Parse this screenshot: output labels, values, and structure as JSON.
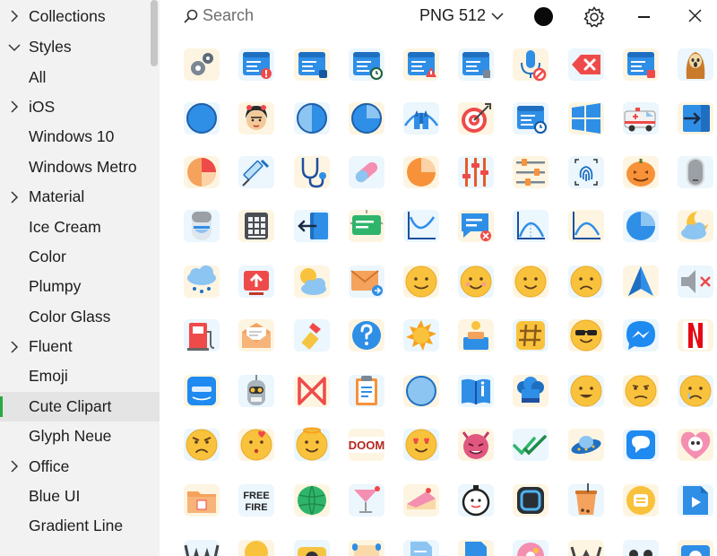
{
  "sidebar": {
    "items": [
      {
        "label": "Collections",
        "expandable": true,
        "expanded": false
      },
      {
        "label": "Styles",
        "expandable": true,
        "expanded": true
      },
      {
        "label": "All"
      },
      {
        "label": "iOS",
        "expandable": true,
        "expanded": false
      },
      {
        "label": "Windows 10"
      },
      {
        "label": "Windows Metro"
      },
      {
        "label": "Material",
        "expandable": true,
        "expanded": false
      },
      {
        "label": "Ice Cream"
      },
      {
        "label": "Color"
      },
      {
        "label": "Plumpy"
      },
      {
        "label": "Color Glass"
      },
      {
        "label": "Fluent",
        "expandable": true,
        "expanded": false
      },
      {
        "label": "Emoji"
      },
      {
        "label": "Cute Clipart",
        "selected": true
      },
      {
        "label": "Glyph Neue"
      },
      {
        "label": "Office",
        "expandable": true,
        "expanded": false
      },
      {
        "label": "Blue UI"
      },
      {
        "label": "Gradient Line"
      }
    ]
  },
  "toolbar": {
    "search_placeholder": "Search",
    "format_label": "PNG 512",
    "color_swatch": "#0a0a0a"
  },
  "colors": {
    "selected_accent": "#27a844",
    "sidebar_bg": "#f2f2f2",
    "blue": "#2f8ee6",
    "yellow": "#f9c23c",
    "red": "#ef4a4a"
  },
  "icons": [
    [
      "gears-icon",
      "website-error-icon",
      "website-user-icon",
      "website-clock-icon",
      "website-warning-icon",
      "website-delete-icon",
      "microphone-off-icon",
      "backspace-icon",
      "website-stop-icon",
      "scream-icon"
    ],
    [
      "blue-circle-icon",
      "frida-kahlo-icon",
      "half-circle-icon",
      "pie-circle-icon",
      "disney-castle-icon",
      "target-icon",
      "calendar-clock-icon",
      "windows-logo-icon",
      "ambulance-icon",
      "import-icon"
    ],
    [
      "pie-chart-icon",
      "syringe-icon",
      "stethoscope-icon",
      "pill-icon",
      "pie-chart-orange-icon",
      "equalizer-icon",
      "sliders-icon",
      "fingerprint-icon",
      "pumpkin-icon",
      "capsule-icon"
    ],
    [
      "humidifier-icon",
      "calculator-icon",
      "logout-icon",
      "announcement-icon",
      "bell-curve-icon",
      "chat-error-icon",
      "arch-chart-icon",
      "parabola-chart-icon",
      "pie-quarter-icon",
      "moon-cloud-icon"
    ],
    [
      "snow-cloud-icon",
      "cloud-upload-icon",
      "partly-cloudy-icon",
      "forward-mail-icon",
      "smile-emoji-icon",
      "blush-emoji-icon",
      "happy-emoji-icon",
      "worried-emoji-icon",
      "location-arrow-icon",
      "mute-icon"
    ],
    [
      "gas-station-icon",
      "open-envelope-icon",
      "lipstick-icon",
      "help-icon",
      "sun-icon",
      "podium-icon",
      "hashtag-icon",
      "cool-emoji-icon",
      "messenger-icon",
      "netflix-icon"
    ],
    [
      "amazon-music-icon",
      "bender-icon",
      "makerbot-icon",
      "clipboard-icon",
      "circle-icon",
      "book-info-icon",
      "chef-hat-icon",
      "grin-emoji-icon",
      "sad-emoji-icon",
      "crying-emoji-icon"
    ],
    [
      "angry-emoji-icon",
      "kiss-emoji-icon",
      "angel-emoji-icon",
      "doom-icon",
      "heart-eyes-emoji-icon",
      "devil-emoji-icon",
      "double-check-icon",
      "ufo-icon",
      "chat-bubble-icon",
      "heart-skull-icon"
    ],
    [
      "folder-icon",
      "free-fire-icon",
      "watermelon-icon",
      "cocktail-icon",
      "cake-icon",
      "smiley-stopwatch-icon",
      "rounded-square-icon",
      "bubble-tea-icon",
      "letter-bubble-icon",
      "video-file-icon"
    ],
    [
      "wwe-icon",
      "hot-air-balloon-icon",
      "camera-icon",
      "scroll-icon",
      "document-icon",
      "file-icon",
      "donut-icon",
      "w-icon",
      "dots-icon",
      "mail-blue-icon"
    ]
  ],
  "icon_labels": {
    "free-fire-icon": [
      "FREE",
      "FIRE"
    ],
    "doom-icon": "DOOM"
  }
}
